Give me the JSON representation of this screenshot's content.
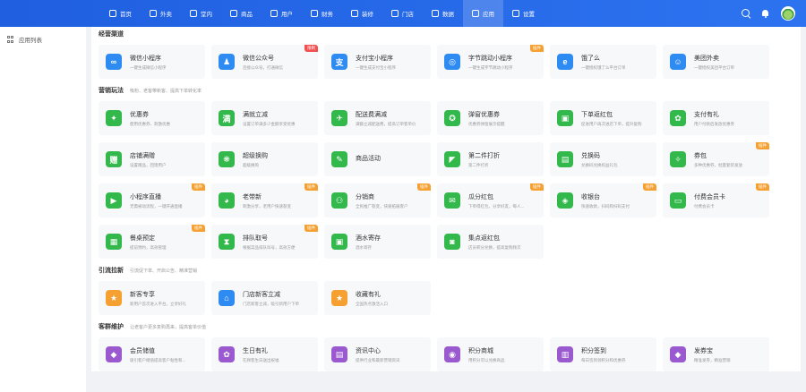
{
  "nav": [
    {
      "label": "首页",
      "icon": "home-icon",
      "active": false
    },
    {
      "label": "外卖",
      "icon": "takeaway-icon",
      "active": false
    },
    {
      "label": "堂内",
      "icon": "dine-in-icon",
      "active": false
    },
    {
      "label": "商品",
      "icon": "goods-icon",
      "active": false
    },
    {
      "label": "用户",
      "icon": "user-icon",
      "active": false
    },
    {
      "label": "财务",
      "icon": "finance-icon",
      "active": false
    },
    {
      "label": "装修",
      "icon": "decor-icon",
      "active": false
    },
    {
      "label": "门店",
      "icon": "store-icon",
      "active": false
    },
    {
      "label": "数据",
      "icon": "data-icon",
      "active": false
    },
    {
      "label": "应用",
      "icon": "app-icon",
      "active": true
    },
    {
      "label": "设置",
      "icon": "settings-icon",
      "active": false
    }
  ],
  "sidebar": {
    "items": [
      {
        "label": "应用列表",
        "icon": "grid-icon"
      }
    ]
  },
  "sections": [
    {
      "title": "经营渠道",
      "desc": "",
      "cards": [
        {
          "name": "微信小程序",
          "desc": "一键生成微信小程序",
          "color": "#2e8bf2",
          "glyph": "∞",
          "badge": "",
          "badge_color": ""
        },
        {
          "name": "微信公众号",
          "desc": "连接公众号，打通微信",
          "color": "#2e8bf2",
          "glyph": "♟",
          "badge": "限制",
          "badge_color": "red"
        },
        {
          "name": "支付宝小程序",
          "desc": "一键生成支付宝小程序",
          "color": "#2e8bf2",
          "glyph": "支",
          "badge": "",
          "badge_color": ""
        },
        {
          "name": "字节跳动小程序",
          "desc": "一键生成字节跳动小程序",
          "color": "#2e8bf2",
          "glyph": "◎",
          "badge": "插件",
          "badge_color": "orange"
        },
        {
          "name": "饿了么",
          "desc": "一键授权饿了么平台订单",
          "color": "#2e8bf2",
          "glyph": "e",
          "badge": "",
          "badge_color": ""
        },
        {
          "name": "美团外卖",
          "desc": "一键授权美团平台订单",
          "color": "#2e8bf2",
          "glyph": "☺",
          "badge": "",
          "badge_color": ""
        }
      ]
    },
    {
      "title": "营销玩法",
      "desc": "吸粉、老客带新客、提高下单转化率",
      "cards": [
        {
          "name": "优惠券",
          "desc": "使用优惠券、刺激优惠",
          "color": "#33b84c",
          "glyph": "✦",
          "badge": "",
          "badge_color": ""
        },
        {
          "name": "满就立减",
          "desc": "设置订单满多少金额享受优惠",
          "color": "#33b84c",
          "glyph": "满",
          "badge": "",
          "badge_color": ""
        },
        {
          "name": "配送费满减",
          "desc": "满额立减配送费，提高订单客单价",
          "color": "#33b84c",
          "glyph": "✈",
          "badge": "",
          "badge_color": ""
        },
        {
          "name": "弹窗优惠券",
          "desc": "优惠券弹窗展示提醒",
          "color": "#33b84c",
          "glyph": "✪",
          "badge": "",
          "badge_color": ""
        },
        {
          "name": "下单返红包",
          "desc": "促进用户再次进店下单，提升复购",
          "color": "#33b84c",
          "glyph": "▣",
          "badge": "",
          "badge_color": ""
        },
        {
          "name": "支付有礼",
          "desc": "用户付款后发放优惠券",
          "color": "#33b84c",
          "glyph": "✿",
          "badge": "",
          "badge_color": ""
        },
        {
          "name": "店铺满赠",
          "desc": "设置赠品，回馈用户",
          "color": "#33b84c",
          "glyph": "赠",
          "badge": "",
          "badge_color": ""
        },
        {
          "name": "超级换购",
          "desc": "超级换购",
          "color": "#33b84c",
          "glyph": "❋",
          "badge": "",
          "badge_color": ""
        },
        {
          "name": "商品活动",
          "desc": "",
          "color": "#33b84c",
          "glyph": "✎",
          "badge": "",
          "badge_color": ""
        },
        {
          "name": "第二件打折",
          "desc": "第二件打折",
          "color": "#33b84c",
          "glyph": "◤",
          "badge": "",
          "badge_color": ""
        },
        {
          "name": "兑换码",
          "desc": "兑换码兑换权益礼包",
          "color": "#33b84c",
          "glyph": "▤",
          "badge": "",
          "badge_color": ""
        },
        {
          "name": "券包",
          "desc": "多种优惠券，批量套装发放",
          "color": "#33b84c",
          "glyph": "✧",
          "badge": "插件",
          "badge_color": "orange"
        },
        {
          "name": "小程序直播",
          "desc": "无需被动流程，一键开通直播",
          "color": "#33b84c",
          "glyph": "▶",
          "badge": "插件",
          "badge_color": "orange"
        },
        {
          "name": "老带新",
          "desc": "刺激分享，老用户快速裂变",
          "color": "#33b84c",
          "glyph": "◕",
          "badge": "插件",
          "badge_color": "orange"
        },
        {
          "name": "分销商",
          "desc": "全民推广裂变，快速拓展客户",
          "color": "#33b84c",
          "glyph": "⚇",
          "badge": "插件",
          "badge_color": "orange"
        },
        {
          "name": "瓜分红包",
          "desc": "下单得红包，分享好友，每人...",
          "color": "#33b84c",
          "glyph": "✉",
          "badge": "插件",
          "badge_color": "orange"
        },
        {
          "name": "收银台",
          "desc": "快速收款，扫码和扫码支付",
          "color": "#33b84c",
          "glyph": "◈",
          "badge": "插件",
          "badge_color": "orange"
        },
        {
          "name": "付费会员卡",
          "desc": "付费会员卡",
          "color": "#33b84c",
          "glyph": "▭",
          "badge": "插件",
          "badge_color": "orange"
        },
        {
          "name": "餐桌预定",
          "desc": "提前预约，高效管理",
          "color": "#33b84c",
          "glyph": "▦",
          "badge": "插件",
          "badge_color": "orange"
        },
        {
          "name": "排队取号",
          "desc": "根据菜品排队叫号，高效方便",
          "color": "#33b84c",
          "glyph": "⧗",
          "badge": "插件",
          "badge_color": "orange"
        },
        {
          "name": "酒水寄存",
          "desc": "酒水寄存",
          "color": "#33b84c",
          "glyph": "▣",
          "badge": "",
          "badge_color": ""
        },
        {
          "name": "集点返红包",
          "desc": "店员积分兑换，提高复购频次",
          "color": "#33b84c",
          "glyph": "◙",
          "badge": "",
          "badge_color": ""
        }
      ]
    },
    {
      "title": "引流拉新",
      "desc": "引流促下单、开启公告、精准营销",
      "cards": [
        {
          "name": "新客专享",
          "desc": "新用户首次进入平台，立享好礼",
          "color": "#f5a031",
          "glyph": "★",
          "badge": "",
          "badge_color": ""
        },
        {
          "name": "门店新客立减",
          "desc": "门店新客立减，吸引新用户下单",
          "color": "#2e8bf2",
          "glyph": "⌂",
          "badge": "",
          "badge_color": ""
        },
        {
          "name": "收藏有礼",
          "desc": "全国热点激活入口",
          "color": "#f5a031",
          "glyph": "★",
          "badge": "",
          "badge_color": ""
        }
      ]
    },
    {
      "title": "客群维护",
      "desc": "让老客户更多复购再来，提高客单价值",
      "cards": [
        {
          "name": "会员储值",
          "desc": "吸引客户储值提高客户粘性和...",
          "color": "#9b59d0",
          "glyph": "◆",
          "badge": "",
          "badge_color": ""
        },
        {
          "name": "生日有礼",
          "desc": "在顾客生日送出祝福",
          "color": "#9b59d0",
          "glyph": "✿",
          "badge": "",
          "badge_color": ""
        },
        {
          "name": "资讯中心",
          "desc": "提供行业和最新营销资讯",
          "color": "#9b59d0",
          "glyph": "▤",
          "badge": "",
          "badge_color": ""
        },
        {
          "name": "积分商城",
          "desc": "用积分可以兑换商品",
          "color": "#9b59d0",
          "glyph": "◉",
          "badge": "",
          "badge_color": ""
        },
        {
          "name": "积分签到",
          "desc": "每日签到领积分和优惠券",
          "color": "#9b59d0",
          "glyph": "▥",
          "badge": "",
          "badge_color": ""
        },
        {
          "name": "发券宝",
          "desc": "精准发券，精准营销",
          "color": "#9b59d0",
          "glyph": "◆",
          "badge": "",
          "badge_color": ""
        }
      ]
    }
  ]
}
